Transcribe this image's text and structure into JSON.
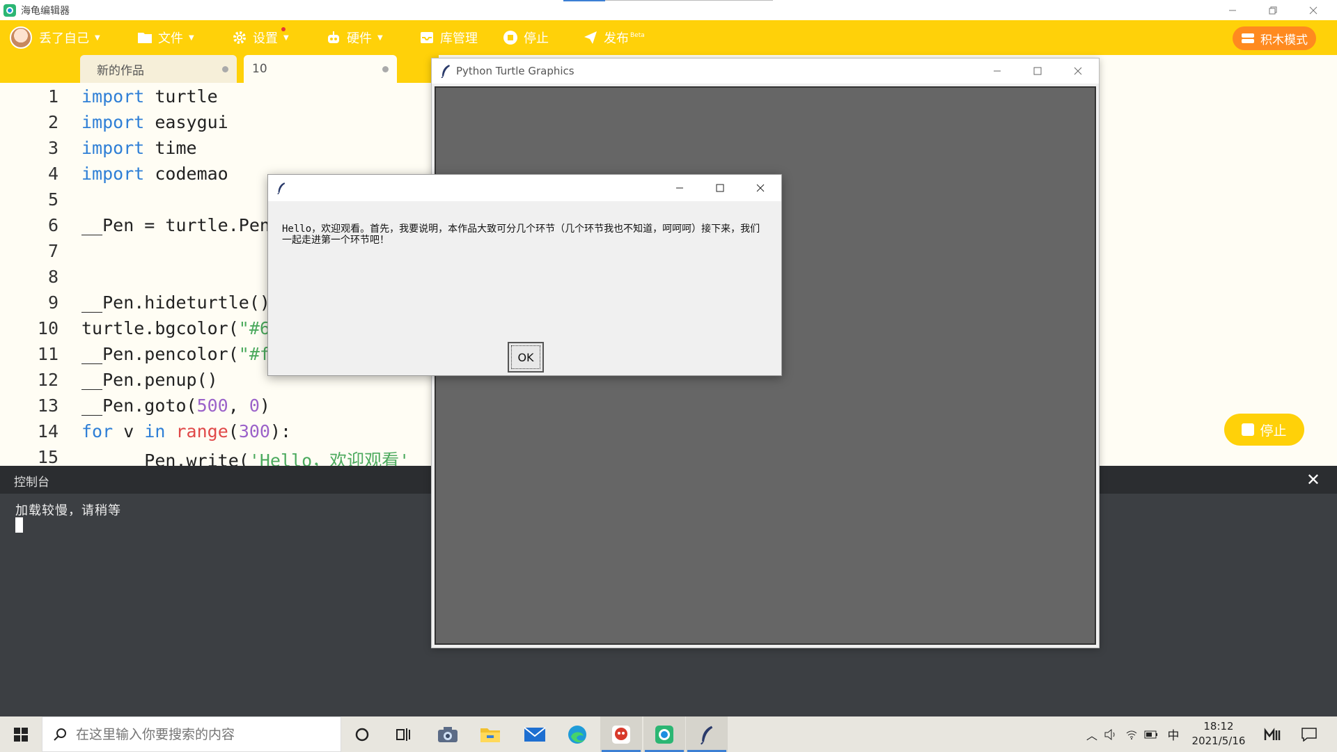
{
  "window": {
    "title": "海龟编辑器"
  },
  "toolbar": {
    "user": "丢了自己",
    "file": "文件",
    "settings": "设置",
    "hardware": "硬件",
    "library": "库管理",
    "stop": "停止",
    "publish": "发布",
    "publish_badge": "Beta",
    "block_mode": "积木模式",
    "accent_color": "#ffd109"
  },
  "tabs": [
    {
      "label": "新的作品"
    },
    {
      "label": "10"
    }
  ],
  "code_lines": [
    {
      "n": "1"
    },
    {
      "n": "2"
    },
    {
      "n": "3"
    },
    {
      "n": "4"
    },
    {
      "n": "5"
    },
    {
      "n": "6"
    },
    {
      "n": "7"
    },
    {
      "n": "8"
    },
    {
      "n": "9"
    },
    {
      "n": "10"
    },
    {
      "n": "11"
    },
    {
      "n": "12"
    },
    {
      "n": "13"
    },
    {
      "n": "14"
    },
    {
      "n": "15"
    }
  ],
  "code": {
    "l1_kw": "import",
    "l1": " turtle",
    "l2_kw": "import",
    "l2": " easygui",
    "l3_kw": "import",
    "l3": " time",
    "l4_kw": "import",
    "l4": " codemao",
    "l6": "__Pen = turtle.Pen",
    "l9": "__Pen.hideturtle()",
    "l10": "turtle.bgcolor(",
    "l10_str": "\"#6",
    "l11": "__Pen.pencolor(",
    "l11_str": "\"#f",
    "l12": "__Pen.penup()",
    "l13_a": "__Pen.goto(",
    "l13_n1": "500",
    "l13_b": ", ",
    "l13_n2": "0",
    "l13_c": ")",
    "l14_kw1": "for",
    "l14_a": " v ",
    "l14_kw2": "in",
    "l14_b": " ",
    "l14_fn": "range",
    "l14_c": "(",
    "l14_n": "300",
    "l14_d": "):",
    "l15": "      Pen.write(",
    "l15_str": "'Hello，欢迎观看'"
  },
  "float_stop": "停止",
  "console": {
    "title": "控制台",
    "output": "加载较慢，请稍等"
  },
  "turtle_window": {
    "title": "Python Turtle Graphics",
    "canvas_color": "#666666"
  },
  "dialog": {
    "message": "Hello，欢迎观看。首先，我要说明，本作品大致可分几个环节（几个环节我也不知道，呵呵呵）接下来，我们一起走进第一个环节吧！",
    "ok": "OK"
  },
  "taskbar": {
    "search_placeholder": "在这里输入你要搜索的内容",
    "ime": "中",
    "time": "18:12",
    "date": "2021/5/16"
  }
}
